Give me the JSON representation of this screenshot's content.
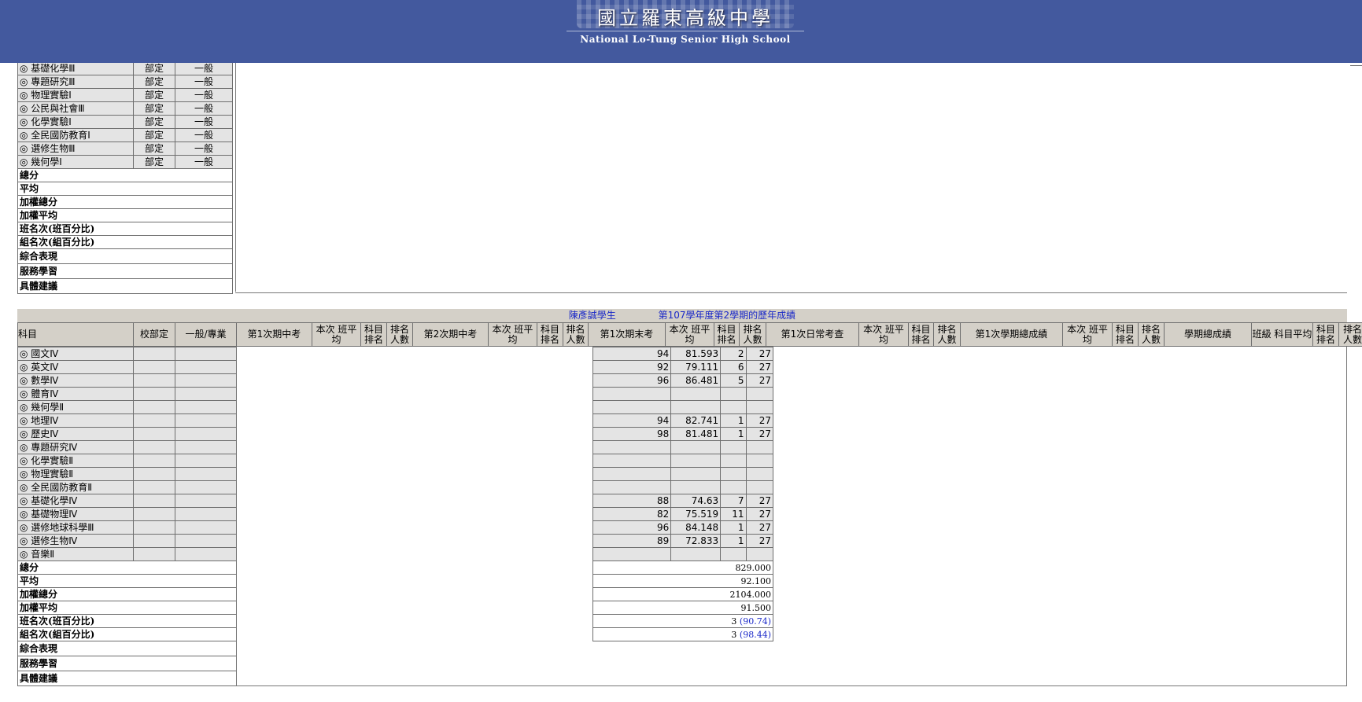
{
  "header": {
    "school_name_cn": "國立羅東高級中學",
    "school_name_en": "National Lo-Tung Senior High School"
  },
  "top_table": {
    "rows": [
      {
        "subject": "◎ 基礎化學Ⅲ",
        "type": "部定",
        "category": "一般"
      },
      {
        "subject": "◎ 專題研究Ⅲ",
        "type": "部定",
        "category": "一般"
      },
      {
        "subject": "◎ 物理實驗Ⅰ",
        "type": "部定",
        "category": "一般"
      },
      {
        "subject": "◎ 公民與社會Ⅲ",
        "type": "部定",
        "category": "一般"
      },
      {
        "subject": "◎ 化學實驗Ⅰ",
        "type": "部定",
        "category": "一般"
      },
      {
        "subject": "◎ 全民國防教育Ⅰ",
        "type": "部定",
        "category": "一般"
      },
      {
        "subject": "◎ 選修生物Ⅲ",
        "type": "部定",
        "category": "一般"
      },
      {
        "subject": "◎ 幾何學Ⅰ",
        "type": "部定",
        "category": "一般"
      }
    ],
    "summary_labels": [
      "總分",
      "平均",
      "加權總分",
      "加權平均",
      "班名次(班百分比)",
      "組名次(組百分比)",
      "綜合表現",
      "服務學習",
      "具體建議"
    ]
  },
  "semester": {
    "student": "陳彥誠學生",
    "title": "第107學年度第2學期的歷年成績",
    "headers": {
      "subject": "科目",
      "school_dept": "校部定",
      "category": "一般/專業",
      "exam1": "第1次期中考",
      "exam2": "第2次期中考",
      "final": "第1次期末考",
      "daily": "第1次日常考查",
      "sem_total": "第1次學期總成績",
      "class_avg": "本次 班平均",
      "subj_rank": "科目 排名",
      "rank_count": "排名 人數",
      "sem_grade": "學期總成績",
      "class_subj_avg": "班級 科目平均"
    },
    "rows": [
      {
        "subject": "◎ 國文Ⅳ",
        "score": "94",
        "avg": "81.593",
        "rank": "2",
        "count": "27"
      },
      {
        "subject": "◎ 英文Ⅳ",
        "score": "92",
        "avg": "79.111",
        "rank": "6",
        "count": "27"
      },
      {
        "subject": "◎ 數學Ⅳ",
        "score": "96",
        "avg": "86.481",
        "rank": "5",
        "count": "27"
      },
      {
        "subject": "◎ 體育Ⅳ",
        "score": "",
        "avg": "",
        "rank": "",
        "count": ""
      },
      {
        "subject": "◎ 幾何學Ⅱ",
        "score": "",
        "avg": "",
        "rank": "",
        "count": ""
      },
      {
        "subject": "◎ 地理Ⅳ",
        "score": "94",
        "avg": "82.741",
        "rank": "1",
        "count": "27"
      },
      {
        "subject": "◎ 歷史Ⅳ",
        "score": "98",
        "avg": "81.481",
        "rank": "1",
        "count": "27"
      },
      {
        "subject": "◎ 專題研究Ⅳ",
        "score": "",
        "avg": "",
        "rank": "",
        "count": ""
      },
      {
        "subject": "◎ 化學實驗Ⅱ",
        "score": "",
        "avg": "",
        "rank": "",
        "count": ""
      },
      {
        "subject": "◎ 物理實驗Ⅱ",
        "score": "",
        "avg": "",
        "rank": "",
        "count": ""
      },
      {
        "subject": "◎ 全民國防教育Ⅱ",
        "score": "",
        "avg": "",
        "rank": "",
        "count": ""
      },
      {
        "subject": "◎ 基礎化學Ⅳ",
        "score": "88",
        "avg": "74.63",
        "rank": "7",
        "count": "27"
      },
      {
        "subject": "◎ 基礎物理Ⅳ",
        "score": "82",
        "avg": "75.519",
        "rank": "11",
        "count": "27"
      },
      {
        "subject": "◎ 選修地球科學Ⅲ",
        "score": "96",
        "avg": "84.148",
        "rank": "1",
        "count": "27"
      },
      {
        "subject": "◎ 選修生物Ⅳ",
        "score": "89",
        "avg": "72.833",
        "rank": "1",
        "count": "27"
      },
      {
        "subject": "◎ 音樂Ⅱ",
        "score": "",
        "avg": "",
        "rank": "",
        "count": ""
      }
    ],
    "summary": [
      {
        "label": "總分",
        "value": "829.000",
        "pct": ""
      },
      {
        "label": "平均",
        "value": "92.100",
        "pct": ""
      },
      {
        "label": "加權總分",
        "value": "2104.000",
        "pct": ""
      },
      {
        "label": "加權平均",
        "value": "91.500",
        "pct": ""
      },
      {
        "label": "班名次(班百分比)",
        "value": "3",
        "pct": "(90.74)"
      },
      {
        "label": "組名次(組百分比)",
        "value": "3",
        "pct": "(98.44)"
      }
    ],
    "extra_labels": [
      "綜合表現",
      "服務學習",
      "具體建議"
    ]
  }
}
